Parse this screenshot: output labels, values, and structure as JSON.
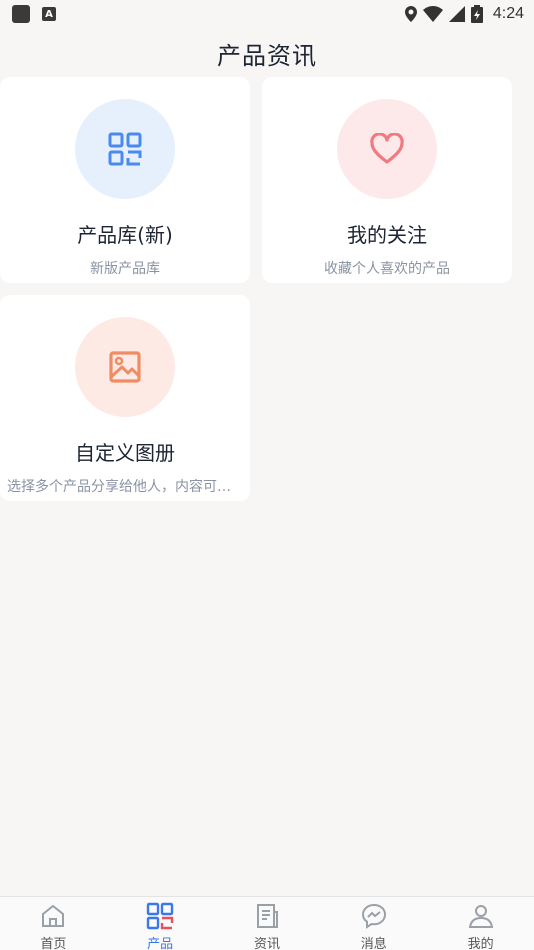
{
  "status_bar": {
    "time": "4:24",
    "a_badge": "A"
  },
  "header": {
    "title": "产品资讯"
  },
  "cards": [
    {
      "title": "产品库(新)",
      "subtitle": "新版产品库",
      "icon": "grid-icon",
      "color": "#4a8af0"
    },
    {
      "title": "我的关注",
      "subtitle": "收藏个人喜欢的产品",
      "icon": "heart-icon",
      "color": "#f07a80"
    },
    {
      "title": "自定义图册",
      "subtitle": "选择多个产品分享给他人，内容可自定义",
      "icon": "image-icon",
      "color": "#f08c64"
    }
  ],
  "tabs": [
    {
      "label": "首页",
      "icon": "home-icon",
      "active": false
    },
    {
      "label": "产品",
      "icon": "product-grid-icon",
      "active": true
    },
    {
      "label": "资讯",
      "icon": "news-icon",
      "active": false
    },
    {
      "label": "消息",
      "icon": "message-icon",
      "active": false
    },
    {
      "label": "我的",
      "icon": "profile-icon",
      "active": false
    }
  ],
  "colors": {
    "accent_blue": "#3b78e7",
    "accent_red": "#e8505b",
    "background": "#f7f6f4"
  }
}
